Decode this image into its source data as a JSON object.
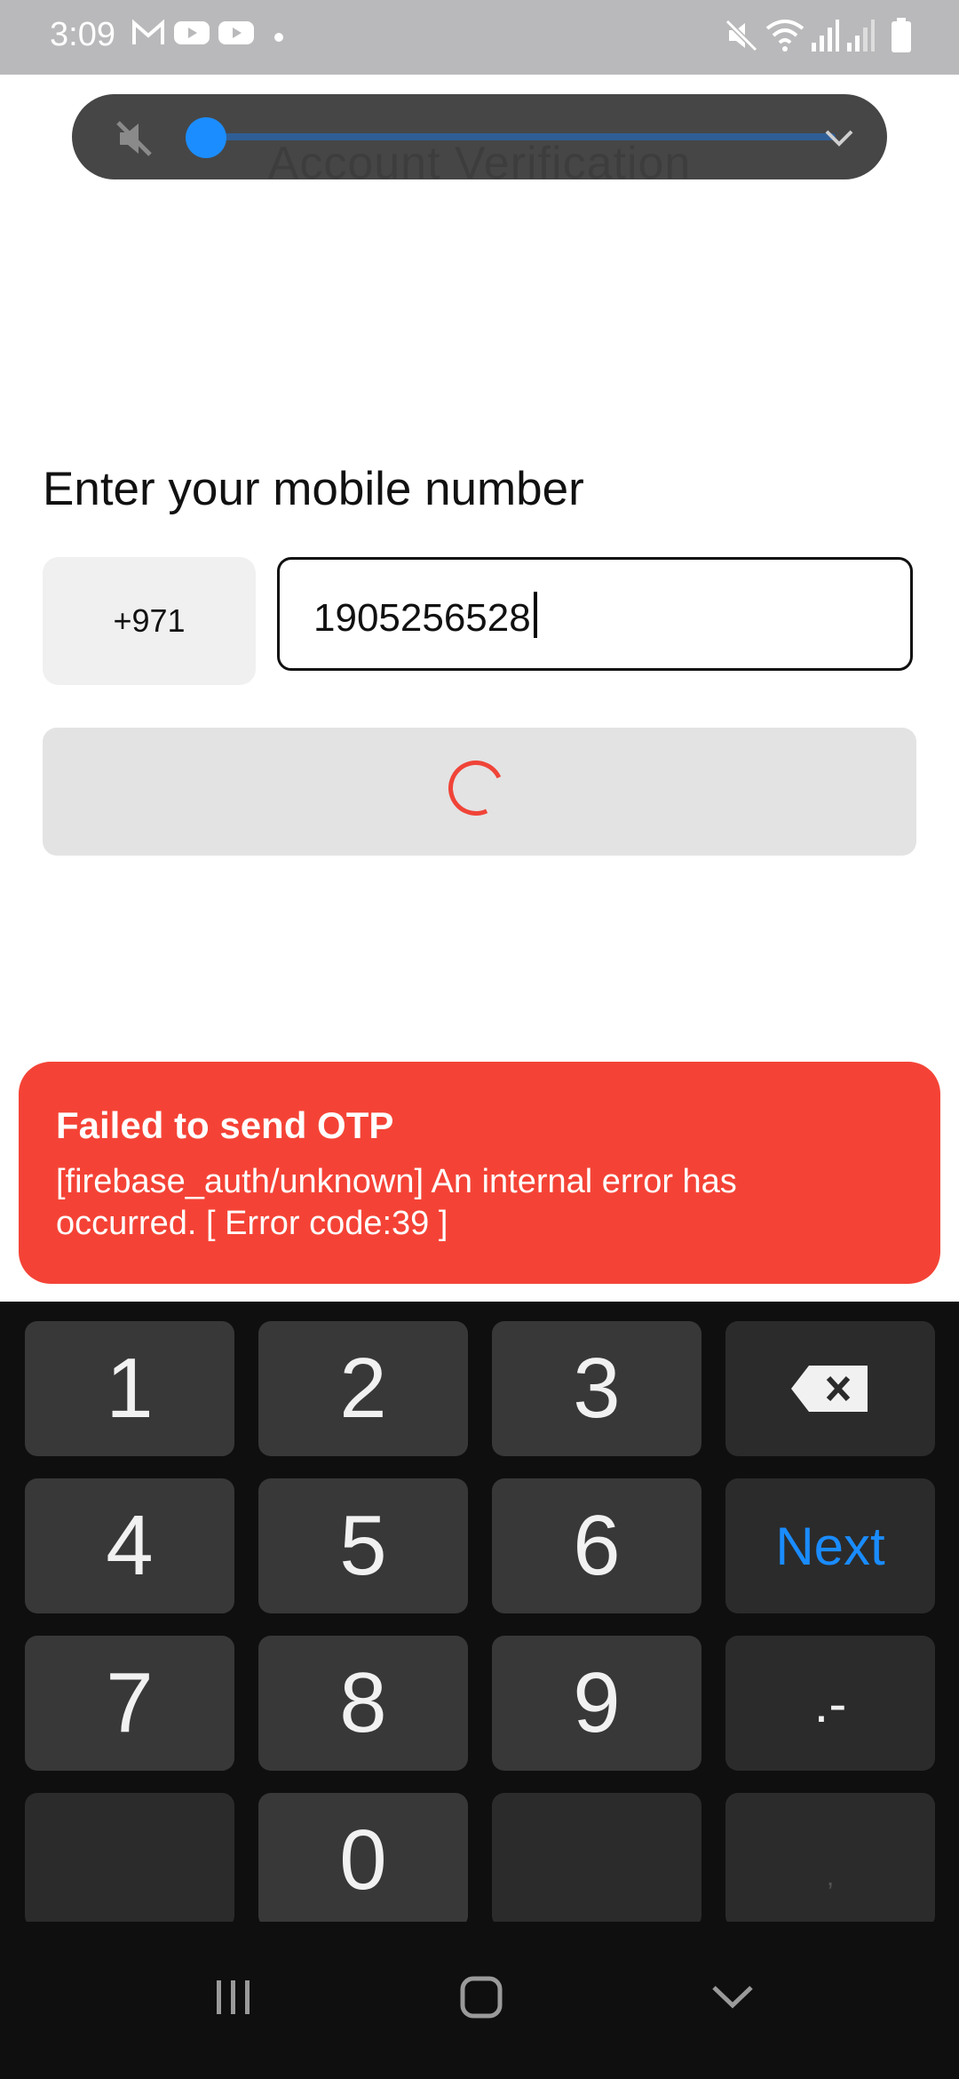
{
  "status_bar": {
    "time": "3:09",
    "left_icons": [
      "gmail-icon",
      "youtube-icon",
      "youtube-icon",
      "dot-icon"
    ],
    "right_icons": [
      "mute-icon",
      "wifi-icon",
      "signal-icon",
      "signal-icon",
      "battery-icon"
    ]
  },
  "volume_panel": {
    "icons": [
      "speaker-muted-icon",
      "chevron-down-icon"
    ],
    "level": 0,
    "accent_color": "#1c8dff"
  },
  "header": {
    "title": "Account Verification"
  },
  "form": {
    "heading": "Enter your mobile number",
    "country_code": "+971",
    "phone_value": "1905256528",
    "submit_state": "loading",
    "spinner_color": "#f04438"
  },
  "snackbar": {
    "title": "Failed to send OTP",
    "message": "[firebase_auth/unknown] An internal error has occurred. [ Error code:39 ]",
    "color": "#f44336"
  },
  "keyboard": {
    "keys": [
      {
        "label": "1"
      },
      {
        "label": "2"
      },
      {
        "label": "3"
      },
      {
        "label": "",
        "icon": "backspace-icon"
      },
      {
        "label": "4"
      },
      {
        "label": "5"
      },
      {
        "label": "6"
      },
      {
        "label": "Next"
      },
      {
        "label": "7"
      },
      {
        "label": "8"
      },
      {
        "label": "9"
      },
      {
        "label": ".-"
      },
      {
        "label": ""
      },
      {
        "label": "0"
      },
      {
        "label": ""
      },
      {
        "label": ","
      }
    ],
    "next_color": "#1a8cff"
  },
  "nav_bar": {
    "buttons": [
      "recents-icon",
      "home-icon",
      "back-chevron-icon"
    ]
  }
}
